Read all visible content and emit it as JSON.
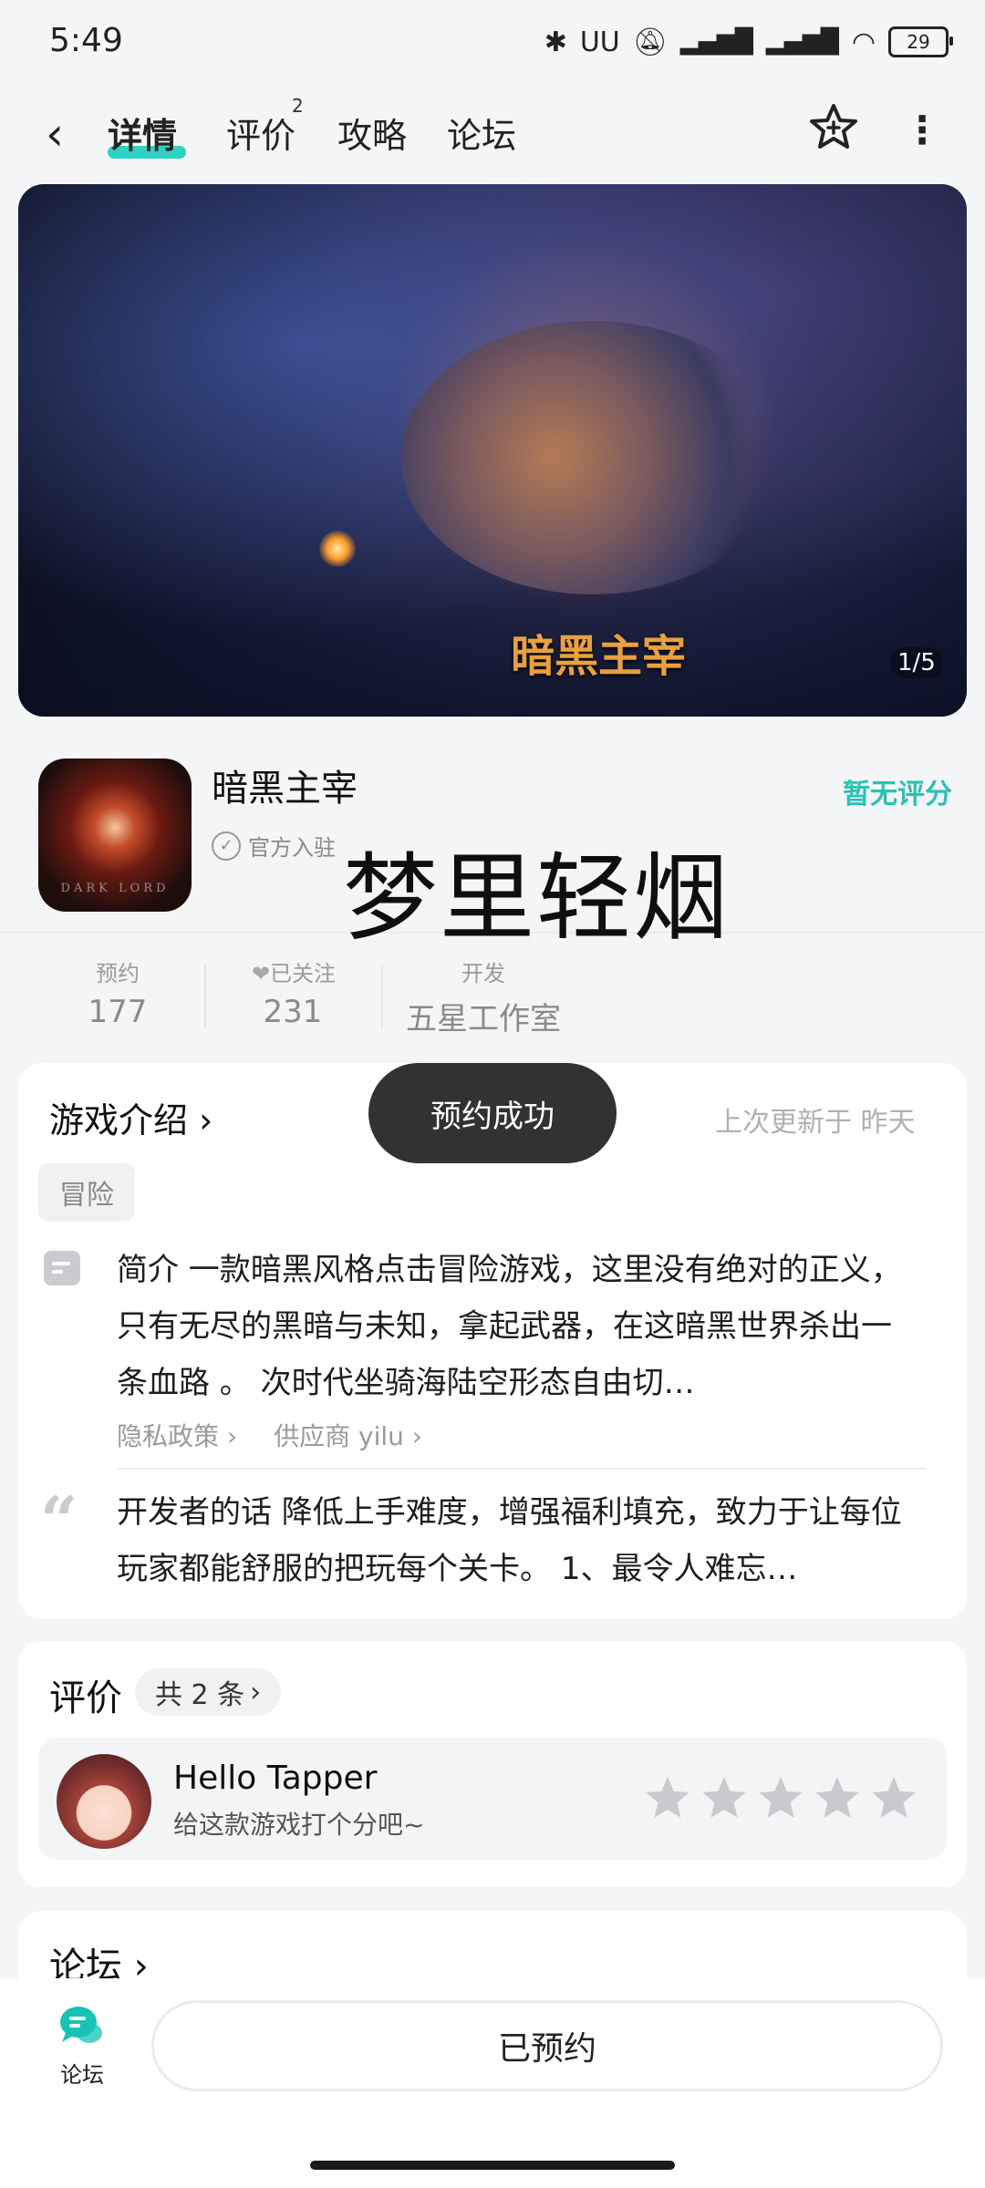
{
  "status_bar": {
    "time": "5:49",
    "battery": "29",
    "icons": [
      "bluetooth-icon",
      "earbuds-icon",
      "mute-icon",
      "signal-hd-icon",
      "signal-hd-icon",
      "wifi-icon",
      "battery-icon"
    ]
  },
  "nav": {
    "tabs": [
      {
        "label": "详情",
        "active": true
      },
      {
        "label": "评价",
        "badge": "2"
      },
      {
        "label": "攻略"
      },
      {
        "label": "论坛"
      }
    ],
    "accent_color": "#2fd1c5"
  },
  "banner": {
    "logo_text": "暗黑主宰",
    "counter": "1/5"
  },
  "app": {
    "name": "暗黑主宰",
    "official": "官方入驻",
    "rating": "暂无评分",
    "icon_text": "DARK LORD",
    "overlay_text": "梦里轻烟"
  },
  "stats": [
    {
      "label": "预约",
      "value": "177"
    },
    {
      "label": "已关注",
      "value": "231"
    },
    {
      "label": "开发",
      "value": "五星工作室"
    }
  ],
  "intro": {
    "title": "游戏介绍",
    "updated": "上次更新于 昨天",
    "tag": "冒险",
    "description": "简介 一款暗黑风格点击冒险游戏，这里没有绝对的正义，只有无尽的黑暗与未知，拿起武器，在这暗黑世界杀出一条血路 。 次时代坐骑海陆空形态自由切…",
    "privacy_link": "隐私政策",
    "supplier_link": "供应商 yilu",
    "dev_words": "开发者的话 降低上手难度，增强福利填充，致力于让每位玩家都能舒服的把玩每个关卡。 1、最令人难忘…"
  },
  "toast": "预约成功",
  "reviews": {
    "title": "评价",
    "count": "共 2 条",
    "user_name": "Hello Tapper",
    "hint": "给这款游戏打个分吧~",
    "stars": 0,
    "max_stars": 5
  },
  "forum": {
    "title": "论坛"
  },
  "bottom_bar": {
    "forum_label": "论坛",
    "reserved_button": "已预约"
  }
}
